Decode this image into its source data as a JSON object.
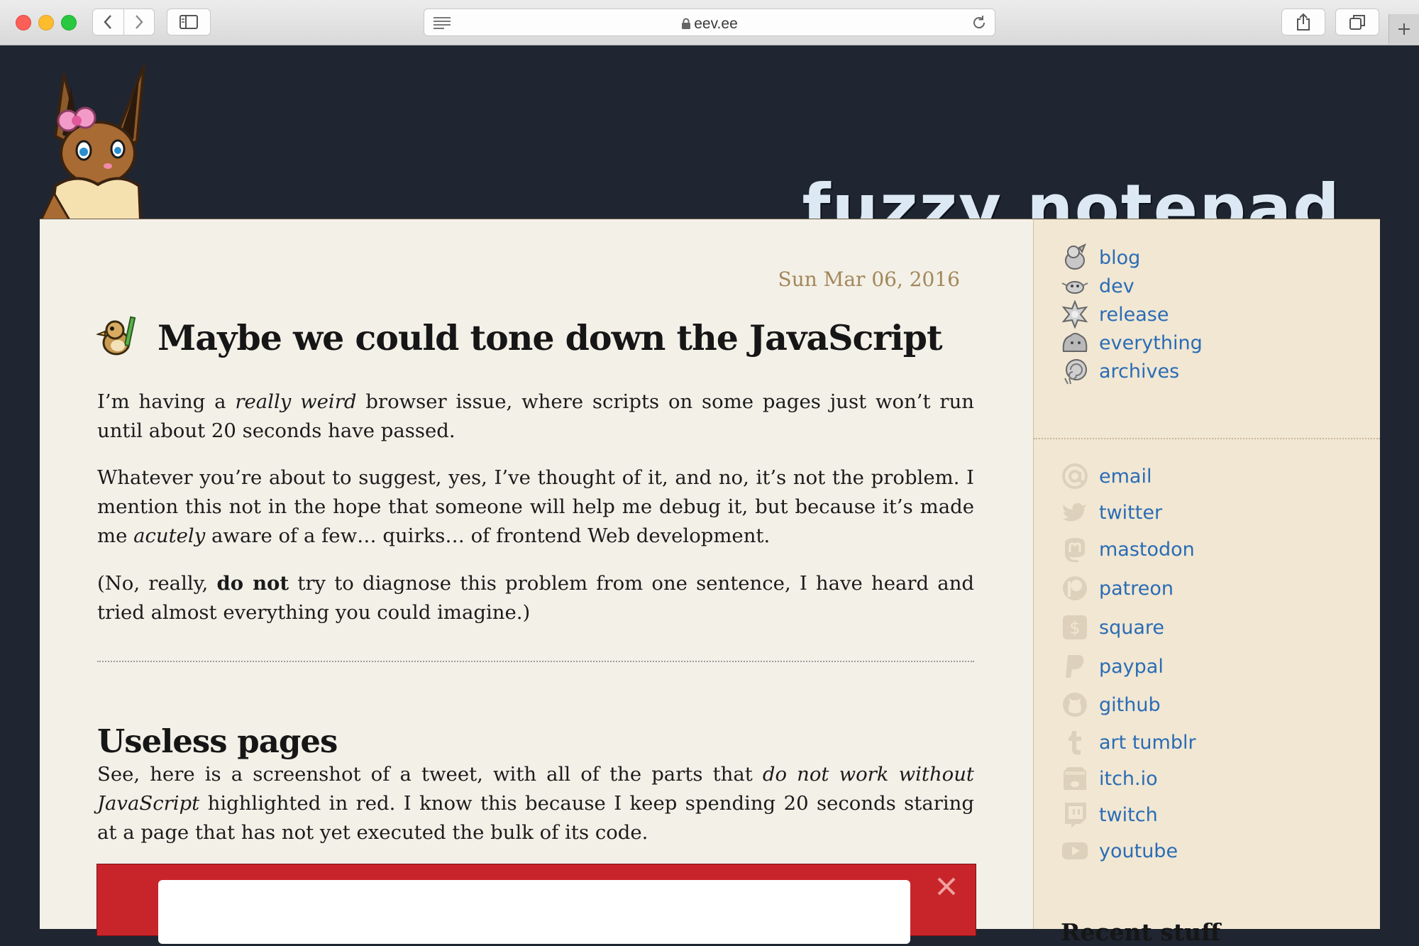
{
  "browser": {
    "url": "eev.ee"
  },
  "site": {
    "title": "fuzzy notepad"
  },
  "post": {
    "date": "Sun Mar 06, 2016",
    "title": "Maybe we could tone down the JavaScript",
    "p1": {
      "a": "I’m having a ",
      "b": "really weird",
      "c": " browser issue, where scripts on some pages just won’t run until about 20 seconds have passed."
    },
    "p2": {
      "a": "Whatever you’re about to suggest, yes, I’ve thought of it, and no, it’s not the problem. I mention this not in the hope that someone will help me debug it, but because it’s made me ",
      "b": "acutely",
      "c": " aware of a few… quirks… of frontend Web development."
    },
    "p3": {
      "a": "(No, really, ",
      "b": "do not",
      "c": " try to diagnose this problem from one sentence, I have heard and tried almost everything you could imagine.)"
    },
    "section_heading": "Useless pages",
    "p4": {
      "a": "See, here is a screenshot of a tweet, with all of the parts that ",
      "b": "do not work without JavaScript",
      "c": " highlighted in red. I know this because I keep spending 20 seconds staring at a page that has not yet executed the bulk of its code."
    }
  },
  "sidebar": {
    "categories": [
      {
        "label": "blog",
        "icon": "pokemon-pidgey-icon"
      },
      {
        "label": "dev",
        "icon": "pokemon-bug-icon"
      },
      {
        "label": "release",
        "icon": "pokemon-spiky-icon"
      },
      {
        "label": "everything",
        "icon": "pokemon-blob-icon"
      },
      {
        "label": "archives",
        "icon": "pokemon-shell-icon"
      }
    ],
    "links": [
      {
        "label": "email",
        "icon": "at-sign-icon"
      },
      {
        "label": "twitter",
        "icon": "twitter-bird-icon"
      },
      {
        "label": "mastodon",
        "icon": "mastodon-icon"
      },
      {
        "label": "patreon",
        "icon": "patreon-icon"
      },
      {
        "label": "square",
        "icon": "dollar-icon"
      },
      {
        "label": "paypal",
        "icon": "paypal-icon"
      },
      {
        "label": "github",
        "icon": "github-cat-icon"
      },
      {
        "label": "art tumblr",
        "icon": "tumblr-icon"
      },
      {
        "label": "itch.io",
        "icon": "itch-icon"
      },
      {
        "label": "twitch",
        "icon": "twitch-icon"
      },
      {
        "label": "youtube",
        "icon": "youtube-icon"
      }
    ],
    "recent_heading": "Recent stuff"
  },
  "colors": {
    "background": "#1f2632",
    "content_bg": "#f3f0e8",
    "sidebar_bg": "#f1e7d3",
    "link": "#2a6cb5",
    "date": "#a38759",
    "title_text": "#dce9f5"
  }
}
